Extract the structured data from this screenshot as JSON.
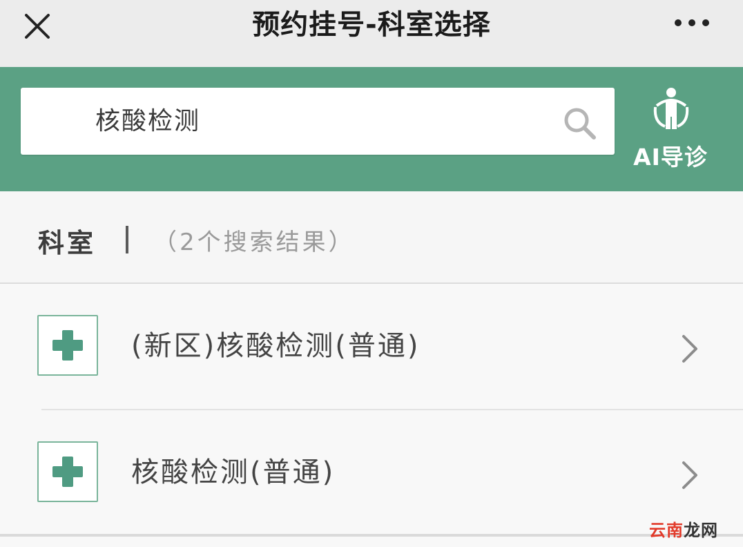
{
  "navbar": {
    "title": "预约挂号-科室选择",
    "close_icon": "close-icon",
    "more_icon": "more-icon"
  },
  "search": {
    "value": "核酸检测",
    "icon": "search-icon"
  },
  "ai_guide": {
    "label": "AI导诊",
    "icon": "person-guide-icon"
  },
  "section": {
    "title": "科室",
    "count_text": "（2个搜索结果）"
  },
  "departments": [
    {
      "name": "(新区)核酸检测(普通)",
      "icon": "medical-cross-icon"
    },
    {
      "name": "核酸检测(普通)",
      "icon": "medical-cross-icon"
    }
  ],
  "watermark": {
    "part1": "云南",
    "part2": "龙网"
  },
  "colors": {
    "brand_green": "#5ba184",
    "cross_green": "#4f9b82",
    "background": "#f4f4f4"
  }
}
